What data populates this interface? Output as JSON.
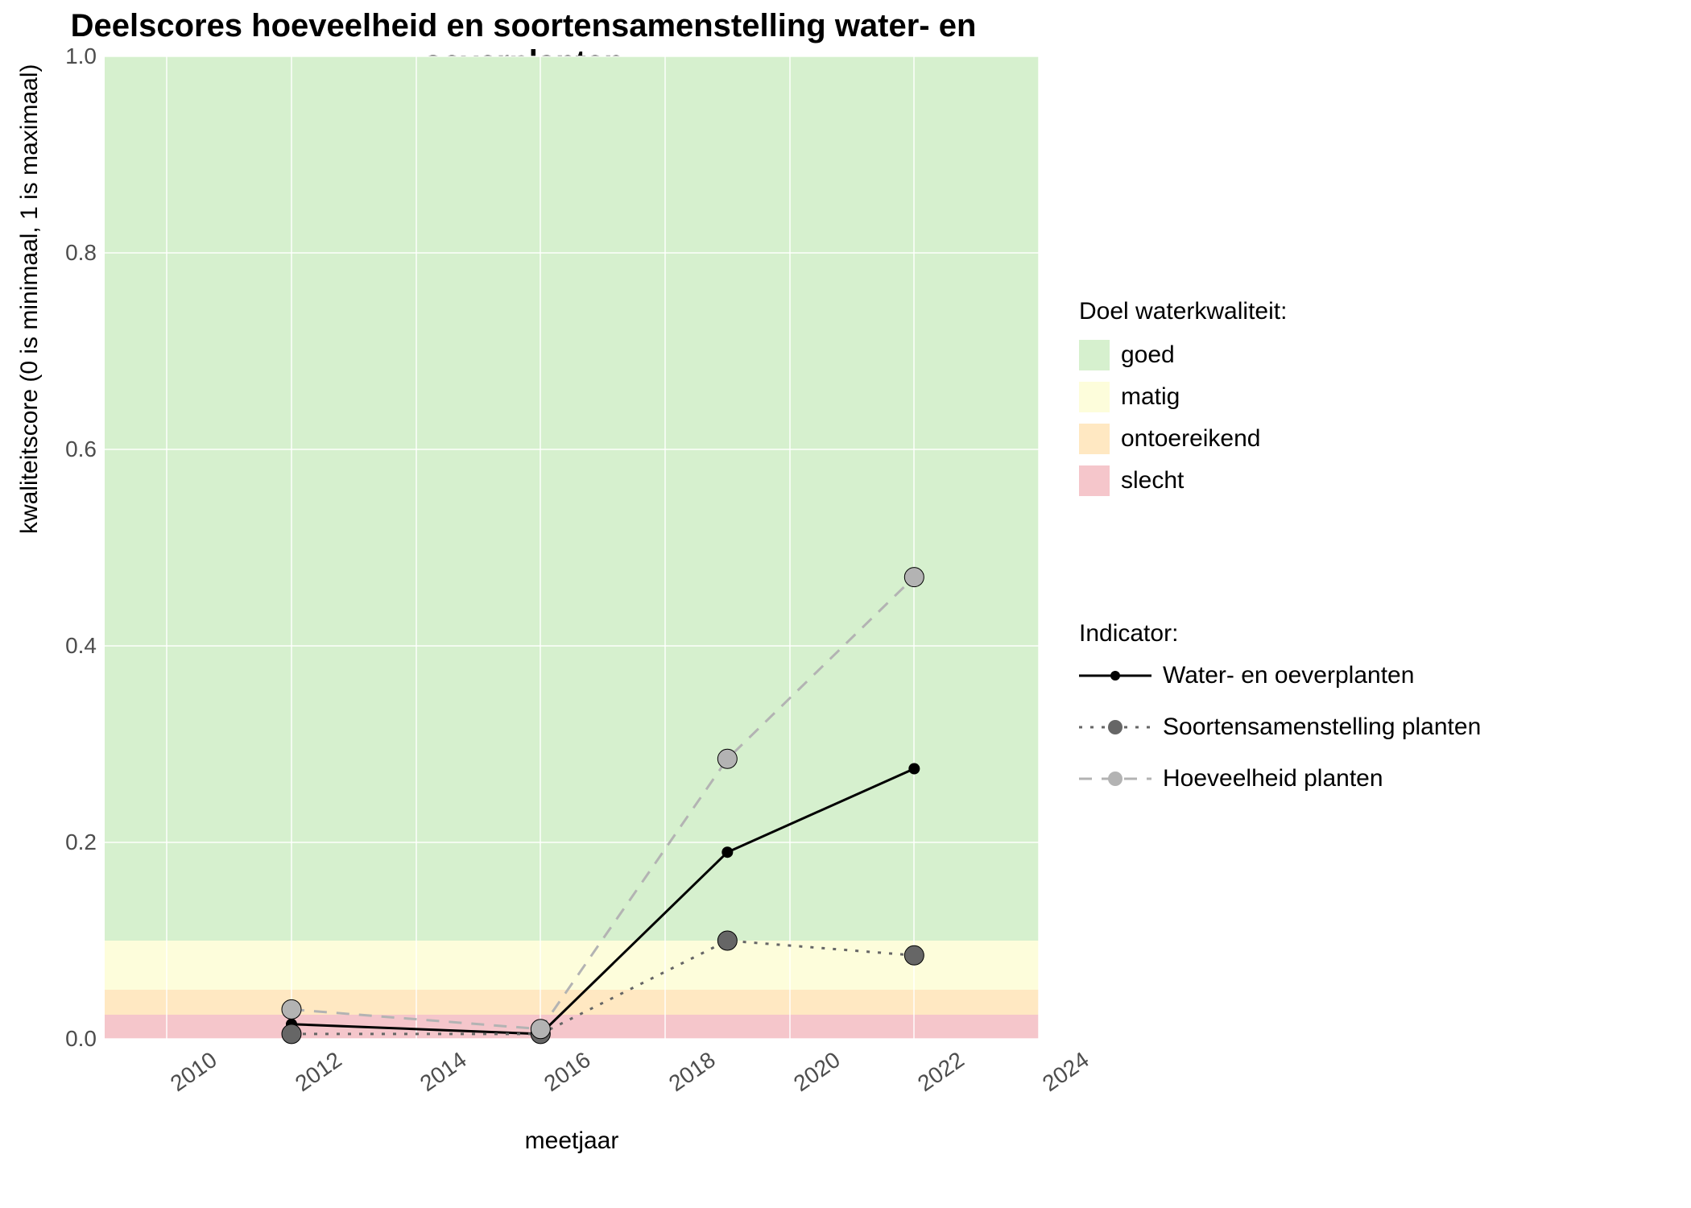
{
  "title": "Deelscores hoeveelheid en soortensamenstelling water- en oeverplanten",
  "xlabel": "meetjaar",
  "ylabel": "kwaliteitscore (0 is minimaal, 1 is maximaal)",
  "y_ticks": [
    "0.0",
    "0.2",
    "0.4",
    "0.6",
    "0.8",
    "1.0"
  ],
  "x_ticks": [
    "2010",
    "2012",
    "2014",
    "2016",
    "2018",
    "2020",
    "2022",
    "2024"
  ],
  "legend_quality_title": "Doel waterkwaliteit:",
  "legend_quality": [
    {
      "label": "goed",
      "color": "#d6f0ce"
    },
    {
      "label": "matig",
      "color": "#fdfddb"
    },
    {
      "label": "ontoereikend",
      "color": "#ffe8c2"
    },
    {
      "label": "slecht",
      "color": "#f5c6cb"
    }
  ],
  "legend_indicator_title": "Indicator:",
  "legend_indicator": [
    {
      "label": "Water- en oeverplanten",
      "color": "#000000",
      "dash": "solid",
      "marker": "#000000",
      "marker_size": 6
    },
    {
      "label": "Soortensamenstelling planten",
      "color": "#666666",
      "dash": "dotted",
      "marker": "#666666",
      "marker_size": 9
    },
    {
      "label": "Hoeveelheid planten",
      "color": "#b3b3b3",
      "dash": "dashed",
      "marker": "#b3b3b3",
      "marker_size": 9
    }
  ],
  "chart_data": {
    "type": "line",
    "title": "Deelscores hoeveelheid en soortensamenstelling water- en oeverplanten",
    "xlabel": "meetjaar",
    "ylabel": "kwaliteitscore (0 is minimaal, 1 is maximaal)",
    "xlim": [
      2009,
      2024
    ],
    "ylim": [
      0.0,
      1.0
    ],
    "x": [
      2012,
      2016,
      2019,
      2022
    ],
    "series": [
      {
        "name": "Water- en oeverplanten",
        "values": [
          0.015,
          0.005,
          0.19,
          0.275
        ],
        "color": "#000000",
        "dash": "solid"
      },
      {
        "name": "Soortensamenstelling planten",
        "values": [
          0.005,
          0.005,
          0.1,
          0.085
        ],
        "color": "#666666",
        "dash": "dotted"
      },
      {
        "name": "Hoeveelheid planten",
        "values": [
          0.03,
          0.01,
          0.285,
          0.47
        ],
        "color": "#b3b3b3",
        "dash": "dashed"
      }
    ],
    "bands": [
      {
        "name": "slecht",
        "ymin": 0.0,
        "ymax": 0.025,
        "color": "#f5c6cb"
      },
      {
        "name": "ontoereikend",
        "ymin": 0.025,
        "ymax": 0.05,
        "color": "#ffe8c2"
      },
      {
        "name": "matig",
        "ymin": 0.05,
        "ymax": 0.1,
        "color": "#fdfddb"
      },
      {
        "name": "goed",
        "ymin": 0.1,
        "ymax": 1.0,
        "color": "#d6f0ce"
      }
    ],
    "legend_position": "right",
    "grid": true
  }
}
